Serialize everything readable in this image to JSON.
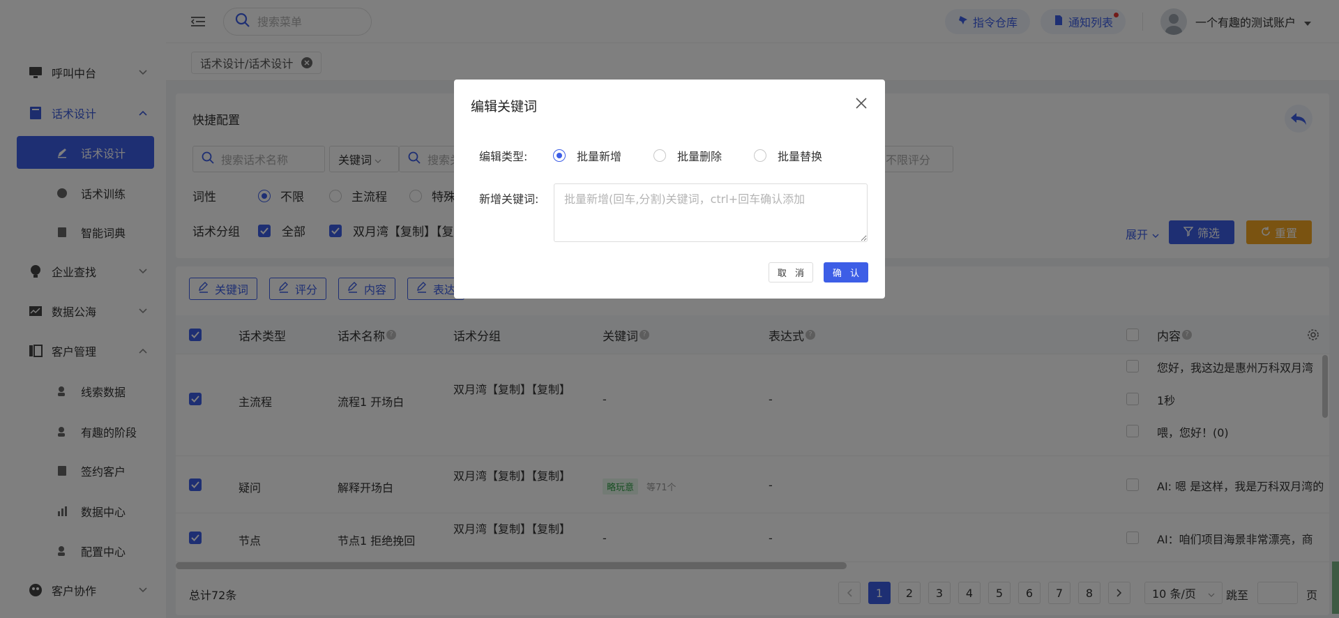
{
  "sidebar": {
    "items": [
      {
        "label": "呼叫中台",
        "icon": "monitor-icon"
      },
      {
        "label": "话术设计",
        "icon": "book-icon"
      },
      {
        "label": "企业查找",
        "icon": "bulb-icon"
      },
      {
        "label": "数据公海",
        "icon": "chart-line-icon"
      },
      {
        "label": "客户管理",
        "icon": "folder-icon"
      },
      {
        "label": "客户协作",
        "icon": "users-icon"
      }
    ],
    "subitems_script": [
      {
        "label": "话术设计",
        "icon": "edit-icon"
      },
      {
        "label": "话术训练",
        "icon": "chat-icon"
      },
      {
        "label": "智能词典",
        "icon": "dictionary-icon"
      }
    ],
    "subitems_customer": [
      {
        "label": "线索数据",
        "icon": "user-search-icon"
      },
      {
        "label": "有趣的阶段",
        "icon": "user-stage-icon"
      },
      {
        "label": "签约客户",
        "icon": "contract-icon"
      },
      {
        "label": "数据中心",
        "icon": "bar-chart-icon"
      },
      {
        "label": "配置中心",
        "icon": "user-config-icon"
      }
    ]
  },
  "header": {
    "search_placeholder": "搜索菜单",
    "cmd_repo": "指令仓库",
    "notice_list": "通知列表",
    "user_name": "一个有趣的测试账户"
  },
  "tabs": {
    "active": "话术设计/话术设计"
  },
  "filter": {
    "title": "快捷配置",
    "search_name_placeholder": "搜索话术名称",
    "keyword_select": "关键词",
    "search_kw_placeholder": "搜索关",
    "score_placeholder": "不限评分",
    "pos_label": "词性",
    "pos_options": [
      "不限",
      "主流程",
      "特殊"
    ],
    "group_label": "话术分组",
    "group_all": "全部",
    "group_first": "双月湾【复制】【复",
    "expand": "展开",
    "filter_btn": "筛选",
    "reset_btn": "重置"
  },
  "toolbar": {
    "keyword": "关键词",
    "score": "评分",
    "content": "内容",
    "expression": "表达"
  },
  "table": {
    "headers": {
      "type": "话术类型",
      "name": "话术名称",
      "group": "话术分组",
      "keyword": "关键词",
      "expression": "表达式",
      "content": "内容"
    },
    "rows": [
      {
        "type": "主流程",
        "name": "流程1 开场白",
        "group": "双月湾【复制】【复制】",
        "keyword": "-",
        "expression": "-",
        "content": [
          "您好，我这边是惠州万科双月湾",
          "1秒",
          "喂，您好！(0)"
        ]
      },
      {
        "type": "疑问",
        "name": "解释开场白",
        "group": "双月湾【复制】【复制】",
        "keyword_tag": "略玩意",
        "keyword_more": "等71个",
        "expression": "-",
        "content": [
          "AI: 嗯 是这样，我是万科双月湾的"
        ]
      },
      {
        "type": "节点",
        "name": "节点1 拒绝挽回",
        "group": "双月湾【复制】【复制】",
        "keyword": "-",
        "expression": "-",
        "content": [
          "AI：咱们项目海景非常漂亮，商"
        ]
      }
    ]
  },
  "pager": {
    "total": "总计72条",
    "pages": [
      "1",
      "2",
      "3",
      "4",
      "5",
      "6",
      "7",
      "8"
    ],
    "page_size": "10 条/页",
    "jump_label": "跳至",
    "page_unit": "页"
  },
  "dialog": {
    "title": "编辑关键词",
    "type_label": "编辑类型:",
    "options": [
      "批量新增",
      "批量删除",
      "批量替换"
    ],
    "kw_label": "新增关键词:",
    "kw_placeholder": "批量新增(回车,分割)关键词，ctrl+回车确认添加",
    "cancel": "取 消",
    "confirm": "确 认"
  },
  "colors": {
    "primary": "#3d5ee6",
    "warning": "#f5a623",
    "success": "#2f9e44"
  }
}
